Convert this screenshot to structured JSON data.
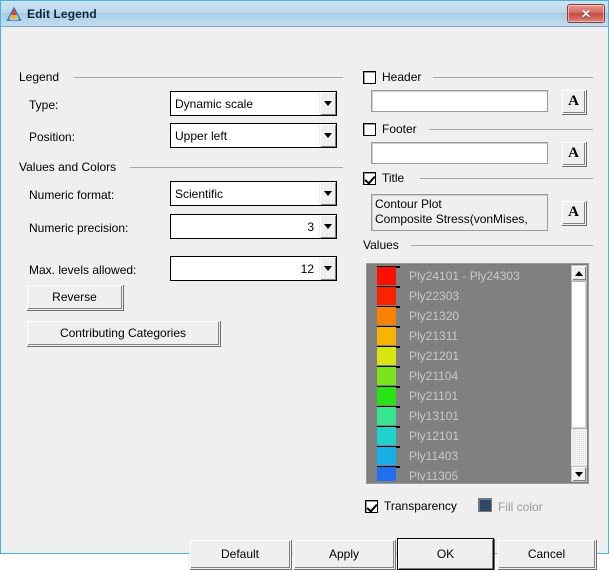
{
  "window": {
    "title": "Edit Legend",
    "icon": "triangle-icon",
    "close_label": "✕"
  },
  "left": {
    "legend_group": "Legend",
    "type_label": "Type:",
    "type_value": "Dynamic scale",
    "position_label": "Position:",
    "position_value": "Upper left",
    "values_colors_group": "Values and Colors",
    "numeric_format_label": "Numeric format:",
    "numeric_format_value": "Scientific",
    "numeric_precision_label": "Numeric precision:",
    "numeric_precision_value": "3",
    "max_levels_label": "Max. levels allowed:",
    "max_levels_value": "12",
    "reverse_label": "Reverse",
    "contributing_label": "Contributing Categories"
  },
  "right": {
    "header_label": "Header",
    "header_checked": false,
    "header_value": "",
    "footer_label": "Footer",
    "footer_checked": false,
    "footer_value": "",
    "title_label": "Title",
    "title_checked": true,
    "title_line1": "Contour Plot",
    "title_line2": "Composite Stress(vonMises,",
    "font_button_label": "A",
    "values_group": "Values",
    "transparency_label": "Transparency",
    "transparency_checked": true,
    "fill_color_label": "Fill color",
    "fill_color_hex": "#2f4b66"
  },
  "values_list": {
    "items": [
      {
        "label": "Ply24101 - Ply24303",
        "color": "#fa0f00"
      },
      {
        "label": "Ply22303",
        "color": "#fa2200"
      },
      {
        "label": "Ply21320",
        "color": "#fa8200"
      },
      {
        "label": "Ply21311",
        "color": "#fab400"
      },
      {
        "label": "Ply21201",
        "color": "#d7e511"
      },
      {
        "label": "Ply21104",
        "color": "#7ae51a"
      },
      {
        "label": "Ply21101",
        "color": "#27e512"
      },
      {
        "label": "Ply13101",
        "color": "#35e58f"
      },
      {
        "label": "Ply12101",
        "color": "#1fd2cd"
      },
      {
        "label": "Ply11403",
        "color": "#18aee8"
      },
      {
        "label": "Ply11305",
        "color": "#1f6ff0"
      }
    ]
  },
  "footer_buttons": {
    "default_label": "Default",
    "apply_label": "Apply",
    "ok_label": "OK",
    "cancel_label": "Cancel"
  }
}
